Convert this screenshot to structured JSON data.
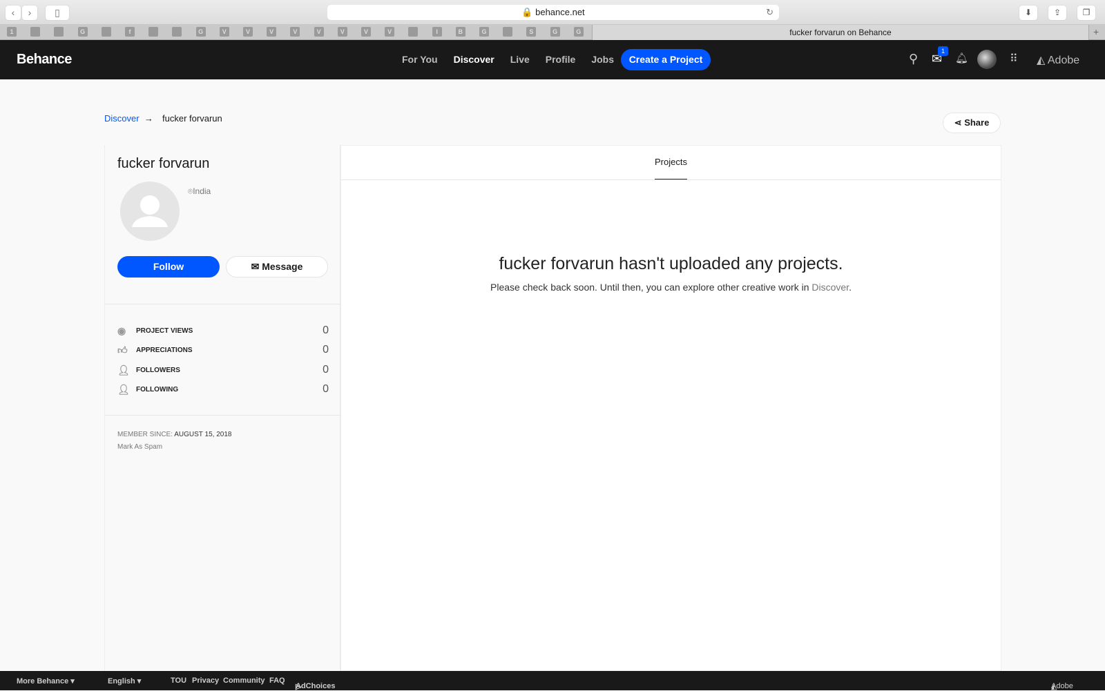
{
  "browser": {
    "url": "behance.net",
    "tab_title": "fucker forvarun on Behance",
    "favicons": [
      "1",
      "",
      "",
      "G",
      "",
      "f",
      "",
      "",
      "G",
      "V",
      "V",
      "V",
      "V",
      "V",
      "V",
      "V",
      "V",
      "",
      "I",
      "B",
      "G",
      "",
      "S",
      "G",
      "G"
    ]
  },
  "header": {
    "logo": "Behance",
    "nav": [
      "For You",
      "Discover",
      "Live",
      "Profile",
      "Jobs"
    ],
    "create": "Create a Project",
    "badge": "1",
    "adobe": "Adobe"
  },
  "breadcrumb": {
    "link": "Discover",
    "arrow": "→",
    "current": "fucker forvarun"
  },
  "share": "Share",
  "profile": {
    "name": "fucker forvarun",
    "location": "India",
    "follow": "Follow",
    "message": "Message",
    "stats": [
      {
        "label": "PROJECT VIEWS",
        "value": "0"
      },
      {
        "label": "APPRECIATIONS",
        "value": "0"
      },
      {
        "label": "FOLLOWERS",
        "value": "0"
      },
      {
        "label": "FOLLOWING",
        "value": "0"
      }
    ],
    "member_since_label": "MEMBER SINCE:",
    "member_since": "AUGUST 15, 2018",
    "spam": "Mark As Spam"
  },
  "main": {
    "tab": "Projects",
    "empty_title": "fucker forvarun hasn't uploaded any projects.",
    "empty_text": "Please check back soon. Until then, you can explore other creative work in ",
    "empty_link": "Discover",
    "empty_end": "."
  },
  "footer": {
    "more": "More Behance ▾",
    "lang": "English ▾",
    "links": [
      "TOU",
      "Privacy",
      "Community",
      "FAQ"
    ],
    "adchoices": "AdChoices",
    "adobe": "Adobe"
  }
}
